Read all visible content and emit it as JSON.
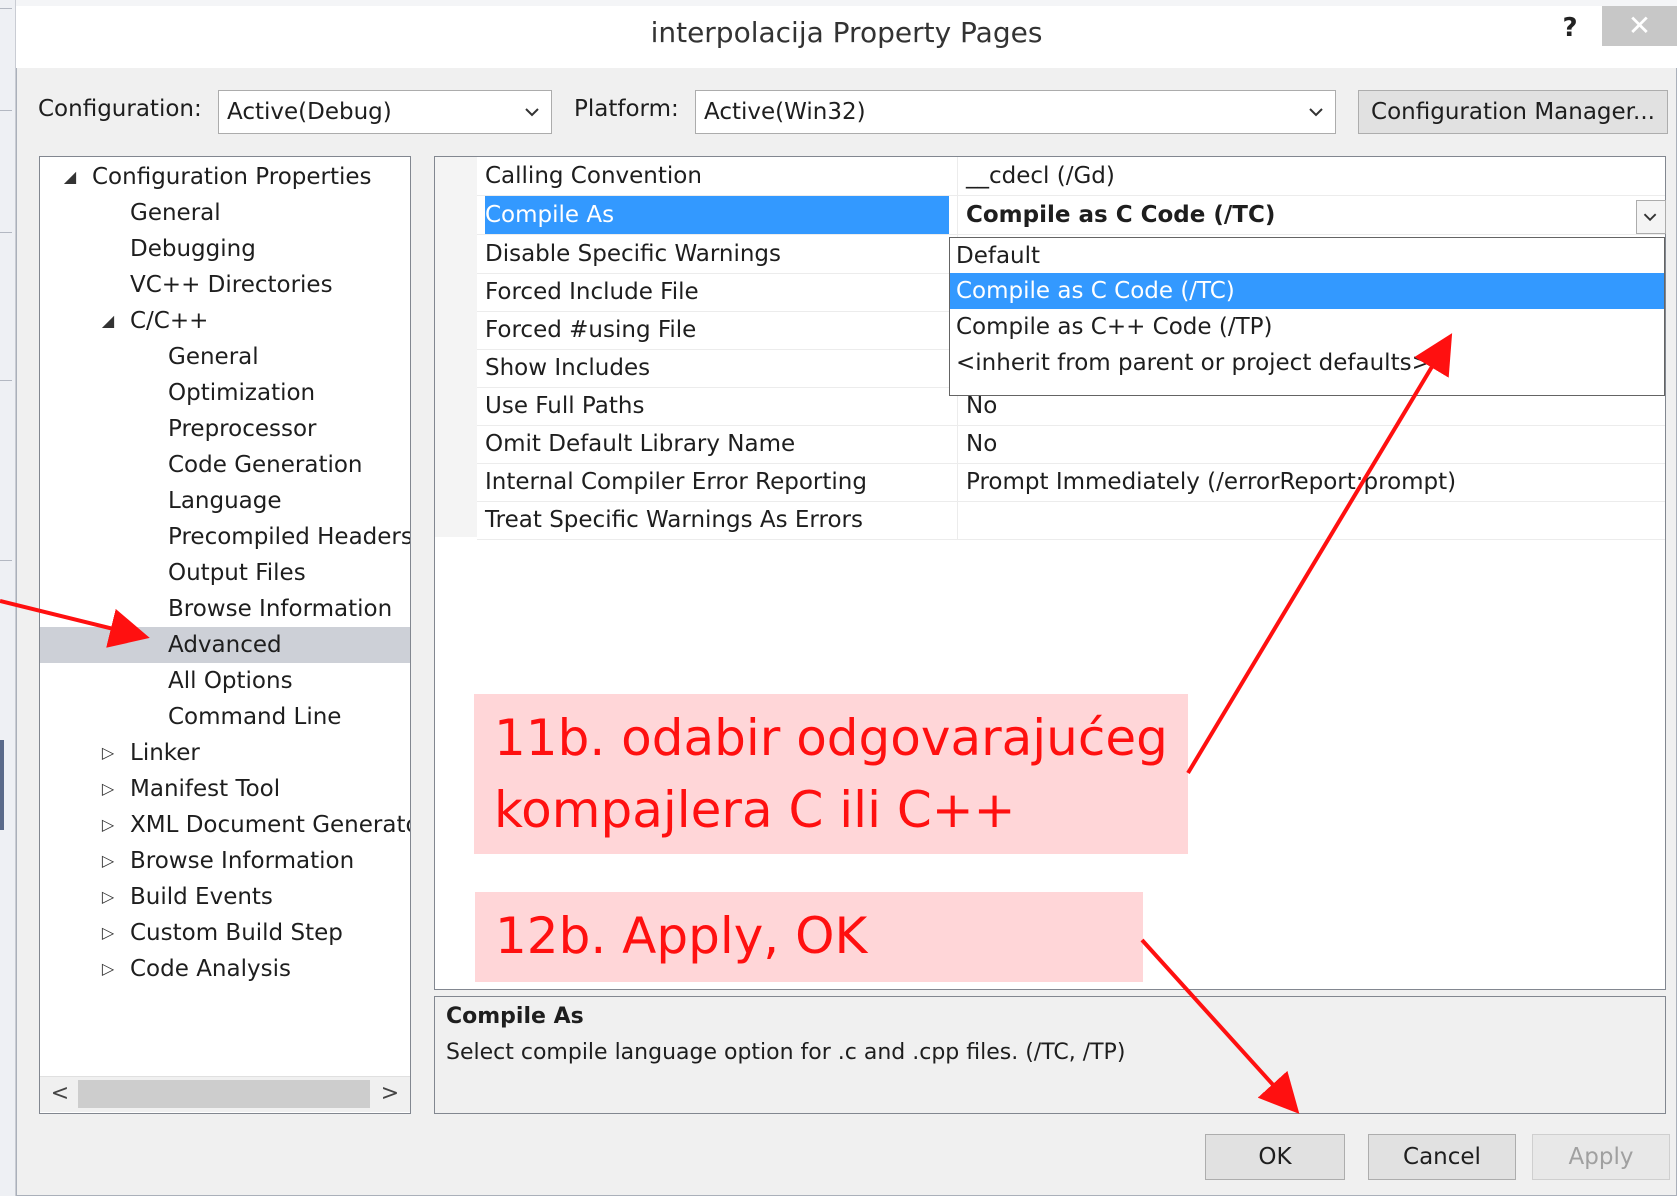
{
  "dialog": {
    "title": "interpolacija Property Pages",
    "help_label": "?",
    "close_label": "✕"
  },
  "config": {
    "configuration_label": "Configuration:",
    "configuration_value": "Active(Debug)",
    "platform_label": "Platform:",
    "platform_value": "Active(Win32)",
    "manager_button": "Configuration Manager..."
  },
  "tree": {
    "items": [
      {
        "label": "Configuration Properties",
        "toggle": "◢"
      },
      {
        "label": "General",
        "toggle": ""
      },
      {
        "label": "Debugging",
        "toggle": ""
      },
      {
        "label": "VC++ Directories",
        "toggle": ""
      },
      {
        "label": "C/C++",
        "toggle": "◢"
      },
      {
        "label": "General",
        "toggle": ""
      },
      {
        "label": "Optimization",
        "toggle": ""
      },
      {
        "label": "Preprocessor",
        "toggle": ""
      },
      {
        "label": "Code Generation",
        "toggle": ""
      },
      {
        "label": "Language",
        "toggle": ""
      },
      {
        "label": "Precompiled Headers",
        "toggle": ""
      },
      {
        "label": "Output Files",
        "toggle": ""
      },
      {
        "label": "Browse Information",
        "toggle": ""
      },
      {
        "label": "Advanced",
        "toggle": ""
      },
      {
        "label": "All Options",
        "toggle": ""
      },
      {
        "label": "Command Line",
        "toggle": ""
      },
      {
        "label": "Linker",
        "toggle": "▷"
      },
      {
        "label": "Manifest Tool",
        "toggle": "▷"
      },
      {
        "label": "XML Document Generator",
        "toggle": "▷"
      },
      {
        "label": "Browse Information",
        "toggle": "▷"
      },
      {
        "label": "Build Events",
        "toggle": "▷"
      },
      {
        "label": "Custom Build Step",
        "toggle": "▷"
      },
      {
        "label": "Code Analysis",
        "toggle": "▷"
      }
    ],
    "scroll_left": "<",
    "scroll_right": ">"
  },
  "properties": [
    {
      "name": "Calling Convention",
      "value": "__cdecl (/Gd)"
    },
    {
      "name": "Compile As",
      "value": "Compile as C Code (/TC)"
    },
    {
      "name": "Disable Specific Warnings",
      "value": ""
    },
    {
      "name": "Forced Include File",
      "value": ""
    },
    {
      "name": "Forced #using File",
      "value": ""
    },
    {
      "name": "Show Includes",
      "value": ""
    },
    {
      "name": "Use Full Paths",
      "value": "No"
    },
    {
      "name": "Omit Default Library Name",
      "value": "No"
    },
    {
      "name": "Internal Compiler Error Reporting",
      "value": "Prompt Immediately (/errorReport:prompt)"
    },
    {
      "name": "Treat Specific Warnings As Errors",
      "value": ""
    }
  ],
  "dropdown": {
    "options": [
      "Default",
      "Compile as C Code (/TC)",
      "Compile as C++ Code (/TP)",
      "<inherit from parent or project defaults>"
    ],
    "selected": "Compile as C Code (/TC)"
  },
  "description": {
    "title": "Compile As",
    "text": "Select compile language option for .c and .cpp files.    (/TC, /TP)"
  },
  "buttons": {
    "ok": "OK",
    "cancel": "Cancel",
    "apply": "Apply"
  },
  "annotations": {
    "note_11b_line1": "11b. odabir odgovarajućeg",
    "note_11b_line2": "kompajlera C ili C++",
    "note_12b": "12b. Apply, OK",
    "color": "#ff1010"
  }
}
